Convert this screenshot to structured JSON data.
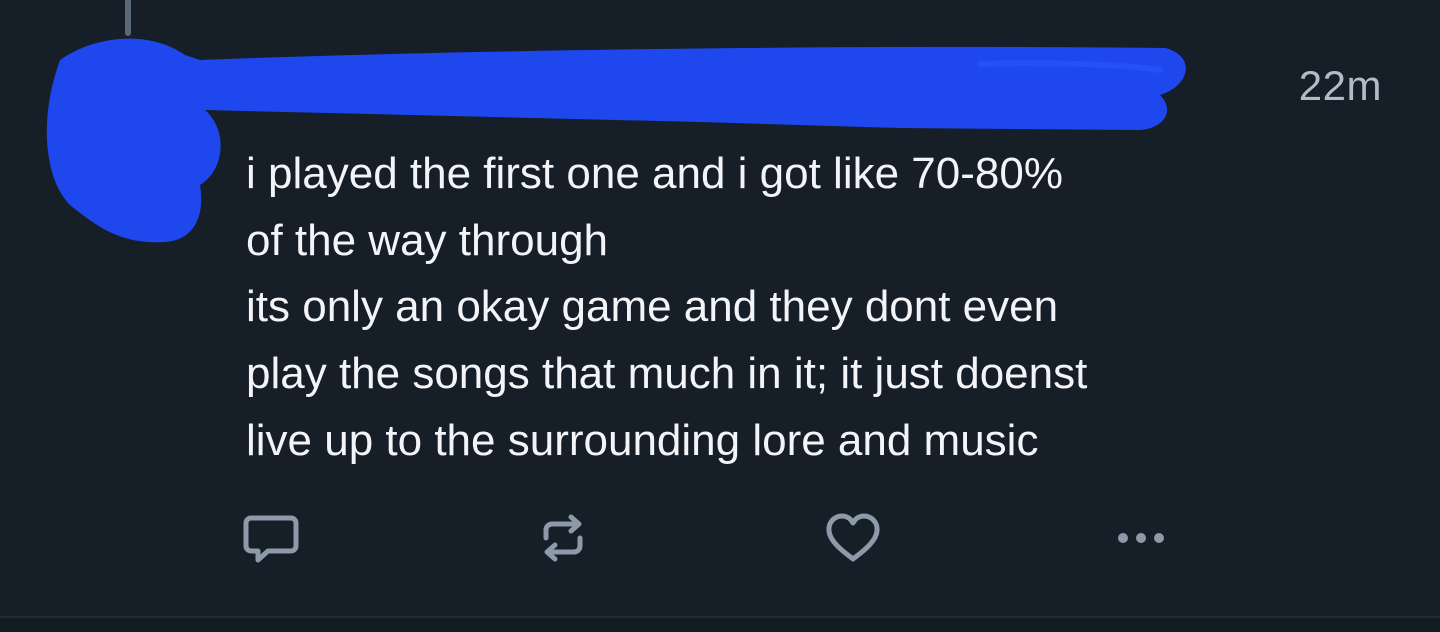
{
  "post": {
    "timestamp": "22m",
    "body_lines": [
      "i played the first one and i got like 70-80%",
      "of the way through",
      "its only an okay game and they dont even",
      "play the songs that much in it; it just doenst",
      "live up to the surrounding lore and music"
    ]
  },
  "actions": [
    {
      "name": "reply",
      "icon": "comment-icon"
    },
    {
      "name": "repost",
      "icon": "repost-icon"
    },
    {
      "name": "like",
      "icon": "heart-icon"
    },
    {
      "name": "more",
      "icon": "more-dots-icon"
    }
  ],
  "colors": {
    "background": "#161e27",
    "text": "#f2f4f7",
    "muted": "#b3bcc6",
    "icon": "#8c9aaa",
    "redaction": "#1f47ee"
  }
}
